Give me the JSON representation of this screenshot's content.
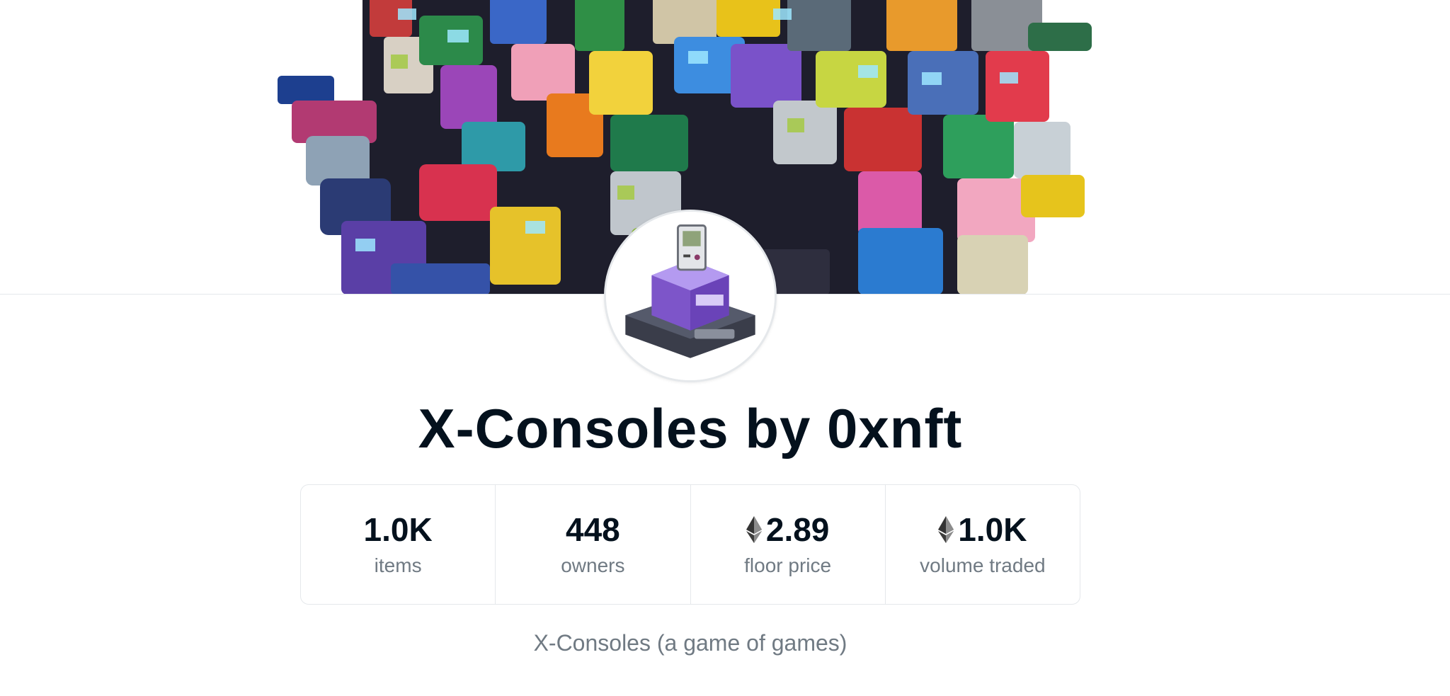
{
  "collection": {
    "title": "X-Consoles by 0xnft",
    "description": "X-Consoles (a game of games)"
  },
  "stats": [
    {
      "value": "1.0K",
      "label": "items",
      "eth": false
    },
    {
      "value": "448",
      "label": "owners",
      "eth": false
    },
    {
      "value": "2.89",
      "label": "floor price",
      "eth": true
    },
    {
      "value": "1.0K",
      "label": "volume traded",
      "eth": true
    }
  ],
  "icons": {
    "currency": "ethereum-icon"
  },
  "colors": {
    "text_primary": "#04111d",
    "text_secondary": "#707a83",
    "border": "#e5e8eb",
    "avatar_purple": "#8e6bd8"
  }
}
